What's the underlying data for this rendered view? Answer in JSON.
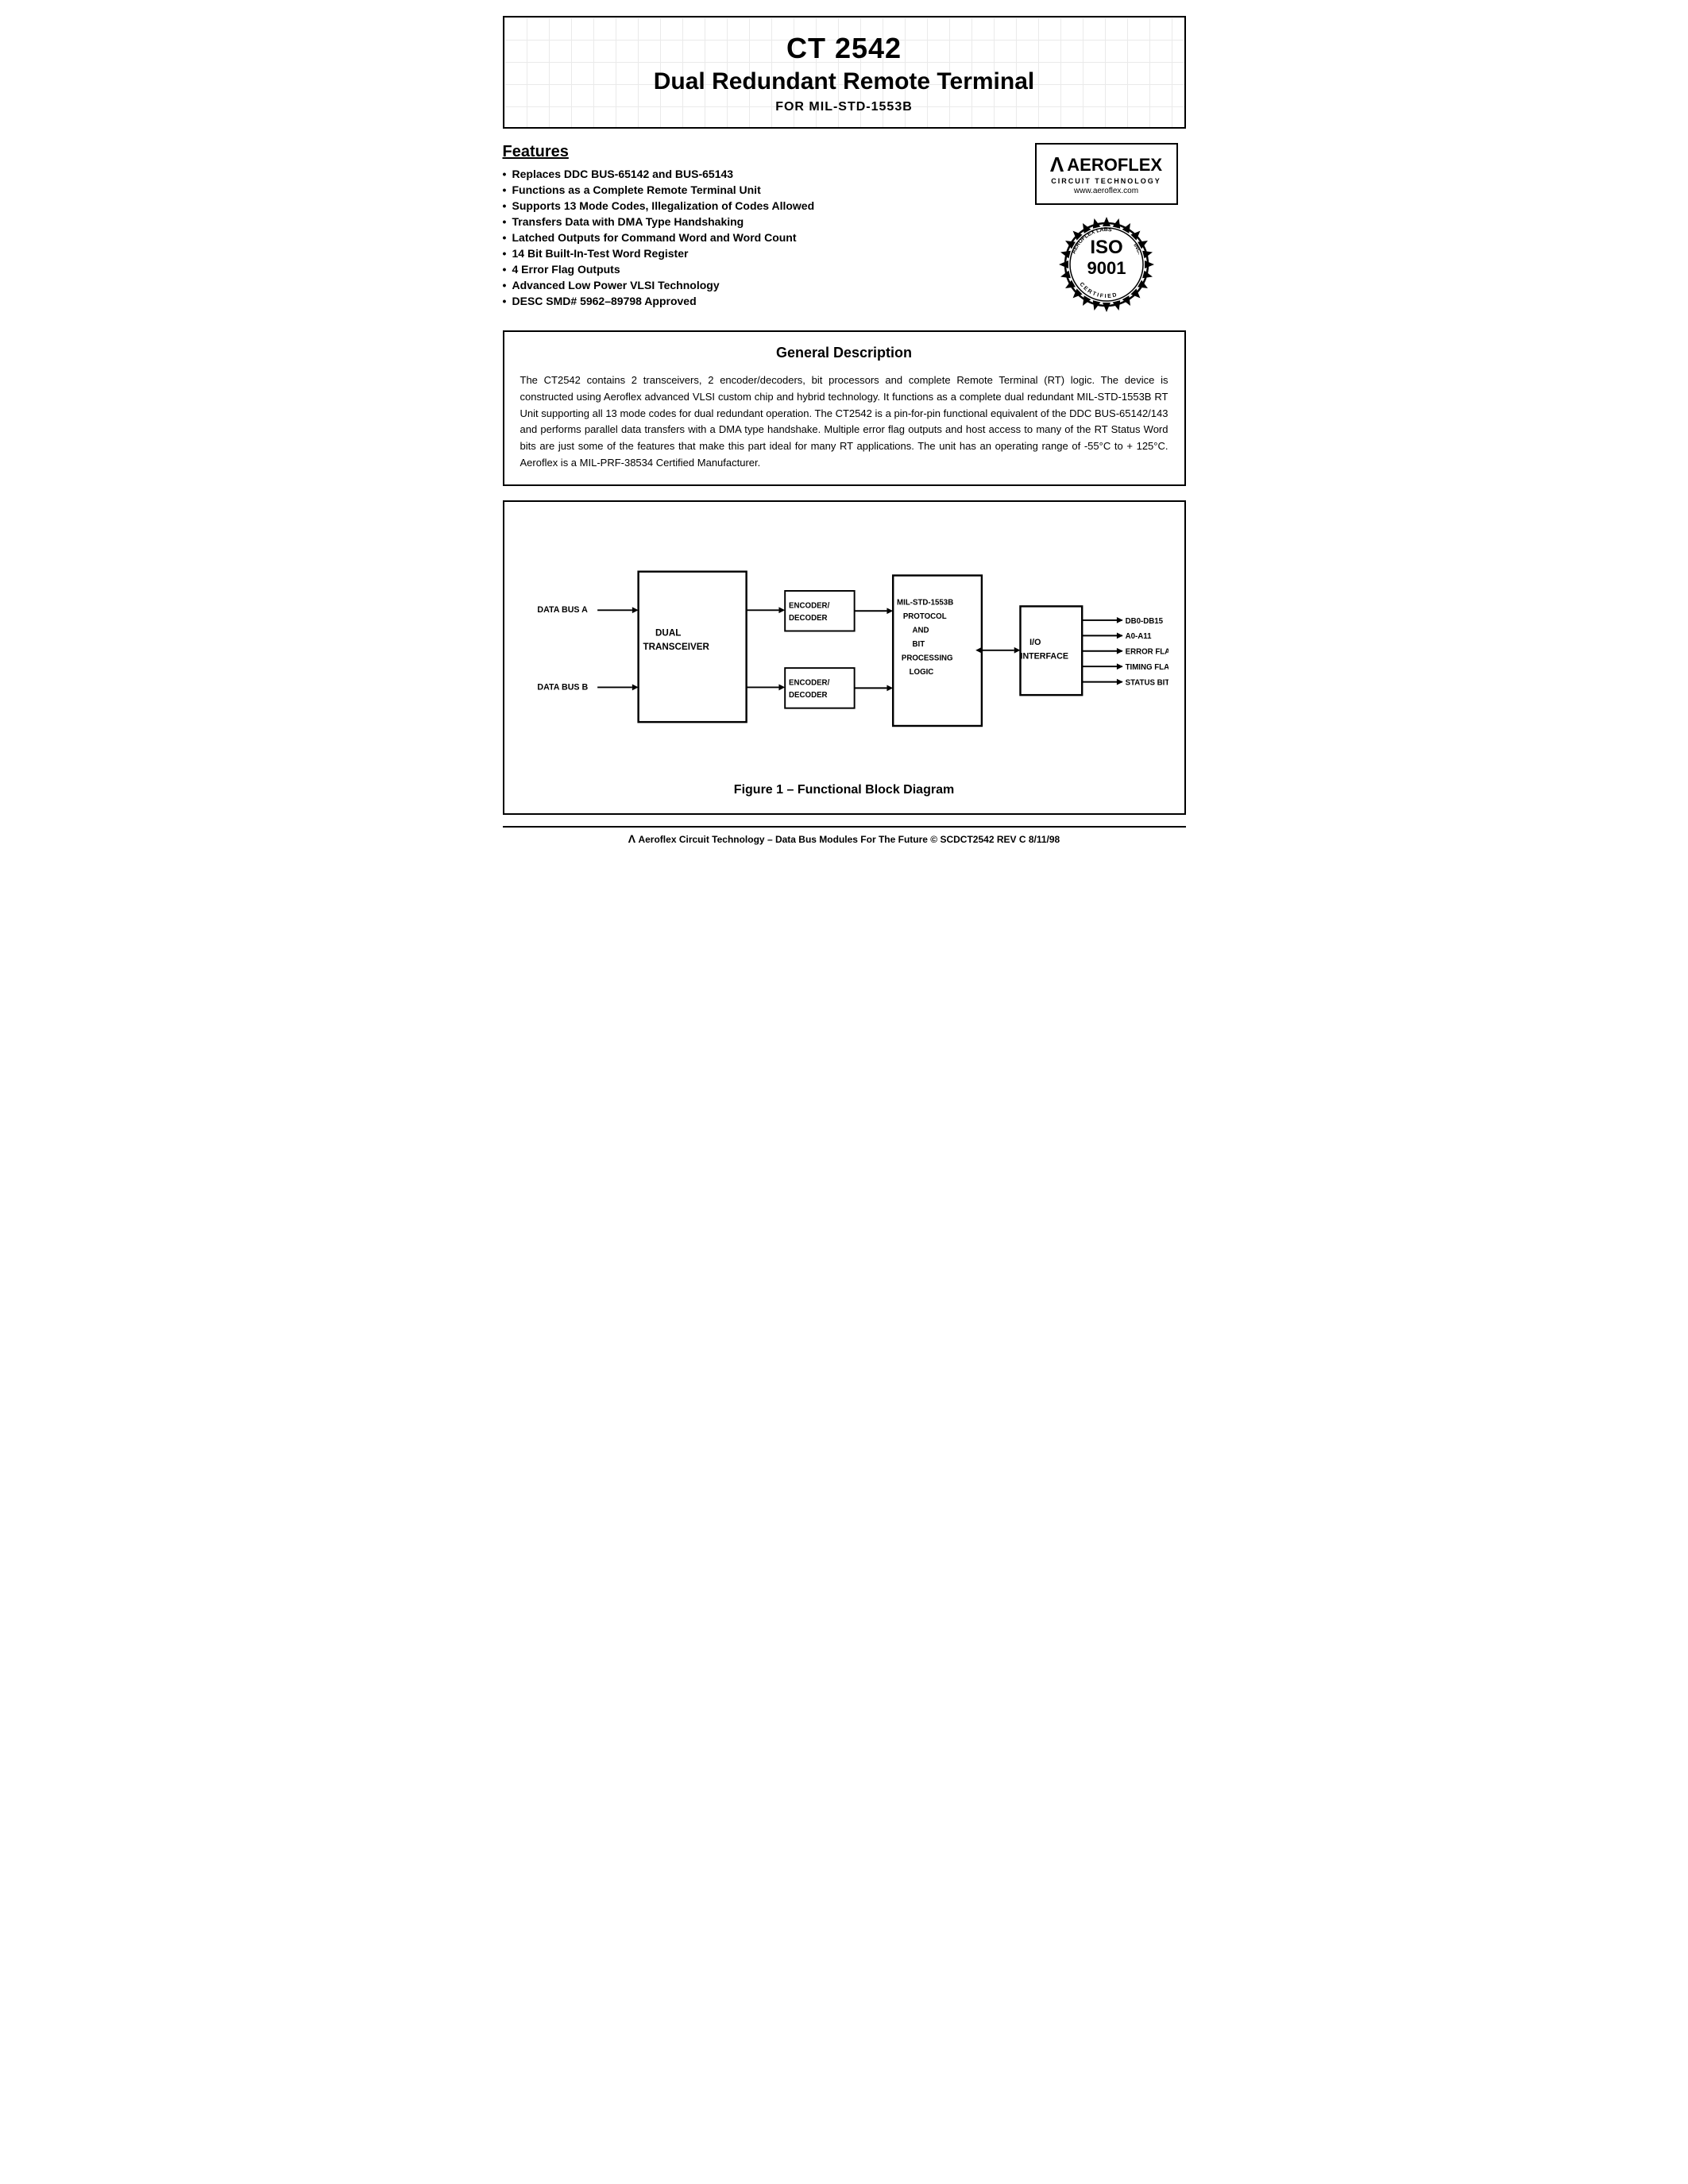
{
  "header": {
    "title_main": "CT 2542",
    "title_sub": "Dual Redundant Remote Terminal",
    "title_for": "FOR MIL-STD-1553B"
  },
  "features": {
    "heading": "Features",
    "items": [
      "Replaces DDC BUS-65142 and BUS-65143",
      "Functions as a Complete Remote Terminal Unit",
      "Supports 13 Mode Codes, Illegalization of Codes Allowed",
      "Transfers Data with DMA Type Handshaking",
      "Latched Outputs for Command Word and Word Count",
      "14 Bit Built-In-Test Word Register",
      "4 Error Flag Outputs",
      "Advanced Low Power VLSI Technology",
      "DESC SMD# 5962–89798 Approved"
    ]
  },
  "aeroflex": {
    "name": "AEROFLEX",
    "sub": "CIRCUIT TECHNOLOGY",
    "url": "www.aeroflex.com"
  },
  "iso": {
    "label": "ISO",
    "number": "9001",
    "ring_text_top": "AEROFLEX LABS",
    "ring_text_bottom": "INC.",
    "ring_text_bottom2": "CERTIFIED"
  },
  "general_description": {
    "title": "General Description",
    "text": "The CT2542 contains 2 transceivers, 2 encoder/decoders, bit processors and complete Remote Terminal (RT) logic. The device is constructed using Aeroflex advanced VLSI custom chip and hybrid technology. It functions as a complete dual redundant MIL-STD-1553B RT Unit supporting all 13 mode codes for dual redundant operation. The CT2542 is a pin-for-pin functional equivalent of the DDC BUS-65142/143 and performs parallel data transfers with a DMA type handshake. Multiple error flag outputs and host access to many of the RT Status Word bits are just some of the features that make this part ideal for many RT applications. The unit has an operating range of -55°C to + 125°C.  Aeroflex is a MIL-PRF-38534 Certified Manufacturer."
  },
  "diagram": {
    "title": "Figure 1 – Functional Block Diagram",
    "blocks": {
      "data_bus_a": "DATA BUS A",
      "data_bus_b": "DATA BUS B",
      "dual": "DUAL",
      "transceiver": "TRANSCEIVER",
      "encoder1": "ENCODER/\nDECODER",
      "encoder2": "ENCODER/\nDECODER",
      "protocol_line1": "MIL-STD-1553B",
      "protocol_line2": "PROTOCOL",
      "protocol_line3": "AND",
      "protocol_line4": "BIT",
      "protocol_line5": "PROCESSING",
      "protocol_line6": "LOGIC",
      "io_label": "I/O",
      "interface": "INTERFACE",
      "outputs": [
        "DB0-DB15",
        "A0-A11",
        "ERROR FLAG",
        "TIMING FLAGS",
        "STATUS BITS"
      ]
    }
  },
  "footer": {
    "text": "Aeroflex Circuit Technology – Data Bus Modules For The Future © SCDCT2542 REV C 8/11/98"
  }
}
